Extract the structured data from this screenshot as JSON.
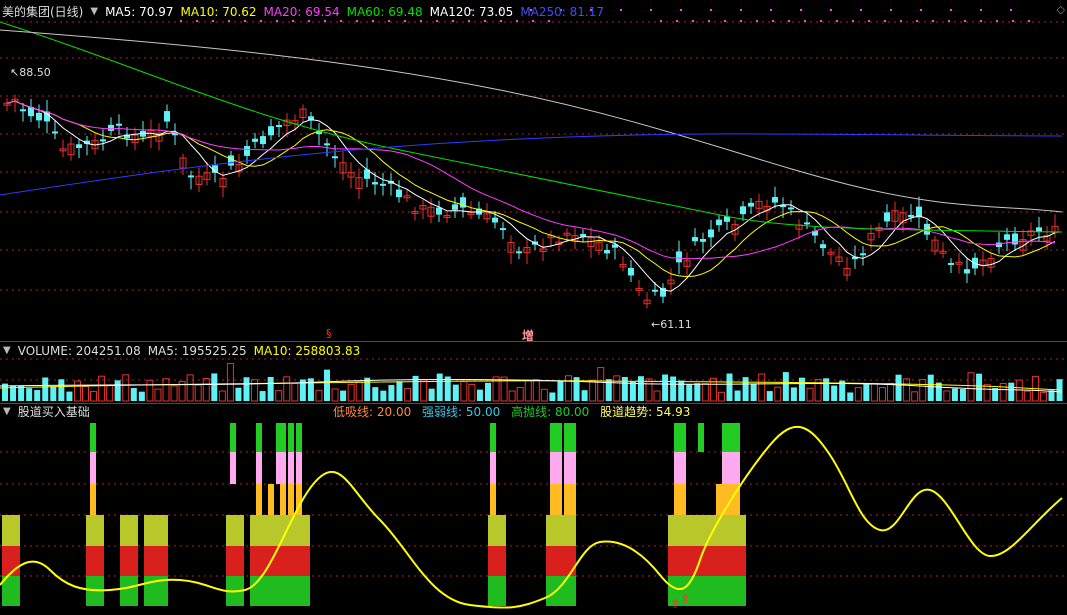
{
  "colors": {
    "up": "#e8322d",
    "down": "#5ff2f5",
    "ma5": "#ffffff",
    "ma10": "#ffff00",
    "ma20": "#ff3cff",
    "ma60": "#00e000",
    "ma120": "#c8c8c8",
    "ma250": "#2a3cff",
    "yellow": "#ffff00",
    "bg": "#000000",
    "grid": "#b0202a"
  },
  "main": {
    "title": "美的集团(日线)",
    "ma": [
      {
        "label": "MA5: 70.97",
        "color": "#ffffff"
      },
      {
        "label": "MA10: 70.62",
        "color": "#ffff00"
      },
      {
        "label": "MA20: 69.54",
        "color": "#ff3cff"
      },
      {
        "label": "MA60: 69.48",
        "color": "#00e000"
      },
      {
        "label": "MA120: 73.05",
        "color": "#ffffff"
      },
      {
        "label": "MA250: 81.17",
        "color": "#2a3cff"
      }
    ],
    "high_label": "88.50",
    "low_label": "61.11",
    "markers": [
      "§",
      "增"
    ]
  },
  "volume": {
    "title": "VOLUME: 204251.08",
    "ma5": "MA5: 195525.25",
    "ma10": "MA10: 258803.83"
  },
  "indicator": {
    "title": "股道买入基础",
    "items": [
      {
        "label": "低吸线: 20.00",
        "color": "#ff8a3c"
      },
      {
        "label": "强弱线: 50.00",
        "color": "#3ac8e6"
      },
      {
        "label": "高抛线: 80.00",
        "color": "#22cc22"
      },
      {
        "label": "股道趋势: 54.93",
        "color": "#ffff66"
      }
    ]
  }
}
